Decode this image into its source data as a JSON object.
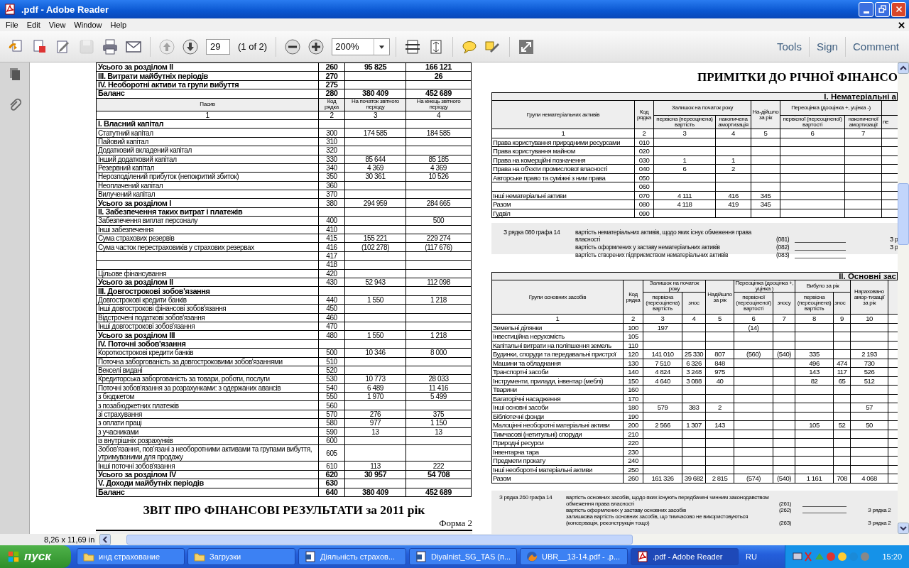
{
  "window": {
    "title": ".pdf - Adobe Reader"
  },
  "menu": [
    "File",
    "Edit",
    "View",
    "Window",
    "Help"
  ],
  "toolbar": {
    "buttons": [
      {
        "kind": "create",
        "disabled": false
      },
      {
        "kind": "convert",
        "disabled": false
      },
      {
        "kind": "sign",
        "disabled": false
      },
      {
        "kind": "save",
        "disabled": true
      },
      {
        "kind": "print",
        "disabled": false
      },
      {
        "kind": "email",
        "disabled": false
      }
    ],
    "navigation": [
      {
        "kind": "previous",
        "disabled": true
      },
      {
        "kind": "next",
        "disabled": false
      }
    ],
    "page": "29",
    "page_count": "(1 of 2)",
    "zoom": "200%",
    "panels": [
      "Tools",
      "Sign",
      "Comment"
    ]
  },
  "left_page": {
    "rows_top": [
      {
        "kind": "total",
        "label": "Усього за розділом II",
        "code": "260",
        "start": "95 825",
        "end": "166 121"
      },
      {
        "kind": "total",
        "label": "III. Витрати майбутніх періодів",
        "code": "270",
        "end": "26"
      },
      {
        "kind": "total",
        "label": "IV. Необоротні активи та групи вибуття",
        "code": "275"
      },
      {
        "kind": "total",
        "label": "Баланс",
        "code": "280",
        "start": "380 409",
        "end": "452 689"
      }
    ],
    "columns": [
      "Пасив",
      "Код рядка",
      "На початок звітного періоду",
      "На кінець звітного періоду"
    ],
    "column_numbers": [
      "1",
      "2",
      "3",
      "4"
    ],
    "rows": [
      {
        "kind": "subtotal",
        "label": "I. Власний капітал"
      },
      {
        "kind": "item",
        "label": "Статутний капітал",
        "code": "300",
        "start": "174 585",
        "end": "184 585"
      },
      {
        "kind": "item",
        "label": "Пайовий капітал",
        "code": "310"
      },
      {
        "kind": "item",
        "label": "Додатковий вкладений капітал",
        "code": "320"
      },
      {
        "kind": "item",
        "label": "Інший додатковий капітал",
        "code": "330",
        "start": "85 644",
        "end": "85 185"
      },
      {
        "kind": "item",
        "label": "Резервний капітал",
        "code": "340",
        "start": "4 369",
        "end": "4 369"
      },
      {
        "kind": "item",
        "label": "Нерозподілений прибуток (непокритий збиток)",
        "code": "350",
        "start": "30 361",
        "end": "10 526"
      },
      {
        "kind": "item",
        "label": "Неоплачений капітал",
        "code": "360"
      },
      {
        "kind": "item",
        "label": "Вилучений капітал",
        "code": "370"
      },
      {
        "kind": "subtotal",
        "label": "Усього за розділом I",
        "code": "380",
        "start": "294 959",
        "end": "284 665"
      },
      {
        "kind": "subtotal",
        "label": "II. Забезпечення  таких витрат і платежів"
      },
      {
        "kind": "item",
        "label": "Забезпечення виплат персоналу",
        "code": "400",
        "end": "500"
      },
      {
        "kind": "item",
        "label": "Інші забезпечення",
        "code": "410"
      },
      {
        "kind": "item",
        "label": "Сума страхових резервів",
        "code": "415",
        "start": "155 221",
        "end": "229 274"
      },
      {
        "kind": "item",
        "label": "Сума часток перестраховиків у страхових резервах",
        "code": "416",
        "start": "(102 278)",
        "end": "(117 676)"
      },
      {
        "kind": "item",
        "code": "417"
      },
      {
        "kind": "item",
        "code": "418"
      },
      {
        "kind": "item",
        "label": "Цільове фінансування",
        "code": "420"
      },
      {
        "kind": "subtotal",
        "label": "Усього за розділом II",
        "code": "430",
        "start": "52 943",
        "end": "112 098"
      },
      {
        "kind": "subtotal",
        "label": "III. Довгострокові зобов'язання"
      },
      {
        "kind": "item",
        "label": "Довгострокові кредити банків",
        "code": "440",
        "start": "1 550",
        "end": "1 218"
      },
      {
        "kind": "item",
        "label": "Інші довгострокові фінансові зобов'язання",
        "code": "450"
      },
      {
        "kind": "item",
        "label": "Відстрочені податкові зобов'язання",
        "code": "460"
      },
      {
        "kind": "item",
        "label": "Інші довгострокові зобов'язання",
        "code": "470"
      },
      {
        "kind": "subtotal",
        "label": "Усього за розділом III",
        "code": "480",
        "start": "1 550",
        "end": "1 218"
      },
      {
        "kind": "subtotal",
        "label": "IV. Поточні зобов'язання"
      },
      {
        "kind": "item",
        "label": "Короткострокові кредити банків",
        "code": "500",
        "start": "10 346",
        "end": "8 000"
      },
      {
        "kind": "item",
        "label": "Поточна заборгованість за довгостроковими зобов'язаннями",
        "code": "510"
      },
      {
        "kind": "item",
        "label": "Векселі видані",
        "code": "520"
      },
      {
        "kind": "item",
        "label": "Кредиторська заборгованість за товари, роботи, послуги",
        "code": "530",
        "start": "10 773",
        "end": "28 033"
      },
      {
        "kind": "item",
        "label": "Поточні зобов'язання за розрахунками: з одержаних авансів",
        "code": "540",
        "start": "6 489",
        "end": "11 416"
      },
      {
        "kind": "item",
        "label": "з бюджетом",
        "code": "550",
        "start": "1 970",
        "end": "5 499"
      },
      {
        "kind": "item",
        "label": "з позабюджетних платежів",
        "code": "560"
      },
      {
        "kind": "item",
        "label": "зі страхування",
        "code": "570",
        "start": "276",
        "end": "375"
      },
      {
        "kind": "item",
        "label": "з оплати праці",
        "code": "580",
        "start": "977",
        "end": "1 150"
      },
      {
        "kind": "item",
        "label": "з учасниками",
        "code": "590",
        "start": "13",
        "end": "13"
      },
      {
        "kind": "item",
        "label": "із внутрішніх розрахунків",
        "code": "600"
      },
      {
        "kind": "item",
        "label": "Зобов’язання, пов’язані з необоротними активами та групами вибуття, утримуваними для продажу",
        "code": "605"
      },
      {
        "kind": "item",
        "label": "Інші поточні зобов'язання",
        "code": "610",
        "start": "113",
        "end": "222"
      },
      {
        "kind": "total",
        "label": "Усього за розділом IV",
        "code": "620",
        "start": "30 957",
        "end": "54 708"
      },
      {
        "kind": "total",
        "label": "V. Доходи майбутніх періодів",
        "code": "630"
      },
      {
        "kind": "total",
        "label": "Баланс",
        "code": "640",
        "start": "380 409",
        "end": "452 689"
      }
    ],
    "report_title": "ЗВІТ ПРО ФІНАНСОВІ РЕЗУЛЬТАТИ за 2011 рік",
    "form_label": "Форма 2"
  },
  "right_page": {
    "title": "ПРИМІТКИ ДО РІЧНОЇ ФІНАНСО",
    "tables": [
      {
        "section_title": "І. Нематеріальні а",
        "columns": [
          {
            "label": "Групи нематеріальних активів"
          },
          {
            "label": "Код рядка"
          },
          {
            "label": "Залишок на початок року",
            "children": [
              {
                "label": "первісна (переоцінена) вартість"
              },
              {
                "label": "накопичена амортизація"
              }
            ]
          },
          {
            "label": "На-дійшло за рік"
          },
          {
            "label": "Переоцінка (дооцінка +, уцінка -)",
            "children": [
              {
                "label": "первісної (переоціненої) вартості"
              },
              {
                "label": "накопиченої амортизації"
              }
            ]
          },
          {
            "children": [
              {
                "label": "пе"
              }
            ]
          }
        ],
        "column_numbers": [
          "1",
          "2",
          "3",
          "4",
          "5",
          "6",
          "7"
        ],
        "rows": [
          {
            "label": "Права користування природними ресурсами",
            "code": "010"
          },
          {
            "label": "Права користування майном",
            "code": "020"
          },
          {
            "label": "Права на комерційні позначення",
            "code": "030",
            "values": {
              "3": "1",
              "4": "1"
            }
          },
          {
            "label": "Права на об'єкти промислової власності",
            "code": "040",
            "values": {
              "3": "6",
              "4": "2"
            }
          },
          {
            "label": "Авторське право та суміжні з ним права",
            "code": "050"
          },
          {
            "code": "060"
          },
          {
            "label": "Інші нематеріальні активи",
            "code": "070",
            "values": {
              "3": "4 111",
              "4": "416",
              "5": "345"
            }
          },
          {
            "label": "Разом",
            "code": "080",
            "values": {
              "3": "4 118",
              "4": "419",
              "5": "345"
            }
          },
          {
            "label": "Гудвіл",
            "code": "090"
          }
        ],
        "note": {
          "reference": "З рядка 080 графа 14",
          "lines": [
            {
              "text": "вартість нематеріальних активів, щодо яких існує обмеження права власності",
              "code": "(081)",
              "blank": true,
              "side": "З р"
            },
            {
              "text": "вартість оформлених у заставу нематеріальних активів",
              "code": "(082)",
              "blank": true,
              "side": "З р"
            },
            {
              "text": "вартість створених підприємством нематеріальних активів",
              "code": "(083)",
              "blank": true
            }
          ]
        }
      },
      {
        "section_title": "ІІ. Основні зас",
        "clipped_column": true,
        "columns": [
          {
            "label": "Групи основних засобів"
          },
          {
            "label": "Код рядка"
          },
          {
            "label": "Залишок на початок року",
            "children": [
              {
                "label": "первісна (переоцінена) вартість"
              },
              {
                "label": "знос"
              }
            ]
          },
          {
            "label": "Надійшло за рік"
          },
          {
            "label": "Переоцінка (дооцінка +, уцінка )",
            "children": [
              {
                "label": "первісної (переоціненої) вартості"
              },
              {
                "label": "зносу"
              }
            ]
          },
          {
            "label": "Вибуло за рік",
            "children": [
              {
                "label": "первісна (переоцінена) вартість"
              },
              {
                "label": "знос"
              }
            ]
          },
          {
            "label": "Нараховано амор-тизації за рік"
          }
        ],
        "column_numbers": [
          "1",
          "2",
          "3",
          "4",
          "5",
          "6",
          "7",
          "8",
          "9",
          "10"
        ],
        "rows": [
          {
            "label": "Земельні ділянки",
            "code": "100",
            "values": {
              "3": "197",
              "6": "(14)"
            }
          },
          {
            "label": "Інвестиційна нерухомість",
            "code": "105"
          },
          {
            "label": "Капітальні витрати на поліпшення земель",
            "code": "110"
          },
          {
            "label": "Будинки, споруди та передавальні пристрої",
            "code": "120",
            "values": {
              "3": "141 010",
              "4": "25 330",
              "5": "807",
              "6": "(560)",
              "7": "(540)",
              "8": "335",
              "10": "2 193"
            }
          },
          {
            "label": "Машини та обладнання",
            "code": "130",
            "values": {
              "3": "7 510",
              "4": "6 326",
              "5": "848",
              "8": "496",
              "9": "474",
              "10": "730"
            }
          },
          {
            "label": "Транспортні засоби",
            "code": "140",
            "values": {
              "3": "4 824",
              "4": "3 248",
              "5": "975",
              "8": "143",
              "9": "117",
              "10": "526"
            }
          },
          {
            "label": "Інструменти, прилади, інвентар (меблі)",
            "code": "150",
            "values": {
              "3": "4 640",
              "4": "3 088",
              "5": "40",
              "8": "82",
              "9": "65",
              "10": "512"
            }
          },
          {
            "label": "Тварини",
            "code": "160"
          },
          {
            "label": "Багаторічні насадження",
            "code": "170"
          },
          {
            "label": "Інші основні засоби",
            "code": "180",
            "values": {
              "3": "579",
              "4": "383",
              "5": "2",
              "10": "57"
            }
          },
          {
            "label": "Бібліотечні фонди",
            "code": "190"
          },
          {
            "label": "Малоцінні необоротні матеріальні активи",
            "code": "200",
            "values": {
              "3": "2 566",
              "4": "1 307",
              "5": "143",
              "8": "105",
              "9": "52",
              "10": "50"
            }
          },
          {
            "label": "Тимчасові (нетитульні) споруди",
            "code": "210"
          },
          {
            "label": "Природні ресурси",
            "code": "220"
          },
          {
            "label": "Інвентарна тара",
            "code": "230"
          },
          {
            "label": "Предмети прокату",
            "code": "240"
          },
          {
            "label": "Інші необоротні матеріальні активи",
            "code": "250"
          },
          {
            "label": "Разом",
            "code": "260",
            "values": {
              "3": "161 326",
              "4": "39 682",
              "5": "2 815",
              "6": "(574)",
              "7": "(540)",
              "8": "1 161",
              "9": "708",
              "10": "4 068"
            }
          }
        ],
        "note": {
          "reference": "З рядка 260 графа 14",
          "lines": [
            {
              "text": "вартість основних засобів, щодо яких існують передбачені чинним законодавством обмеження права власності",
              "code": "(261)",
              "blank": true
            },
            {
              "text": "вартість оформлених у заставу основних засобів",
              "code": "(262)",
              "blank": true,
              "side": "З рядка 2"
            },
            {
              "text": "залишкова вартість основних засобів, що тимчасово не використовуються (консервація, реконструкція тощо)",
              "code": "(263)",
              "blank": false,
              "side": "З рядка 2"
            }
          ]
        }
      }
    ]
  },
  "status_bar": {
    "page_size": "8,26 x 11,69 in"
  },
  "taskbar": {
    "start": "пуск",
    "items": [
      {
        "kind": "folder",
        "label": "инд страхование",
        "selected": false
      },
      {
        "kind": "folder",
        "label": "Загрузки",
        "selected": false
      },
      {
        "kind": "word",
        "label": "Діяльність страхов...",
        "selected": false
      },
      {
        "kind": "word",
        "label": "Diyalnist_SG_TAS (п...",
        "selected": false
      },
      {
        "kind": "firefox",
        "label": "UBR__13-14.pdf - .p...",
        "selected": false
      },
      {
        "kind": "pdf",
        "label": ".pdf - Adobe Reader",
        "selected": true
      }
    ],
    "language": "RU",
    "clock": "15:20"
  }
}
